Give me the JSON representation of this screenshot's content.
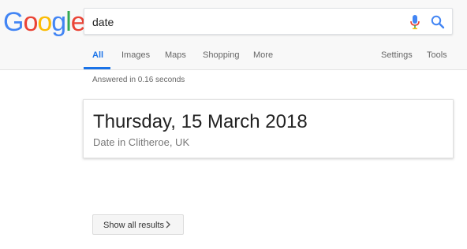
{
  "logo": {
    "letters": [
      "G",
      "o",
      "o",
      "g",
      "l",
      "e"
    ],
    "colors": [
      "#4285F4",
      "#EA4335",
      "#FBBC05",
      "#4285F4",
      "#34A853",
      "#EA4335"
    ]
  },
  "search": {
    "value": "date",
    "icons": {
      "mic": "mic-icon",
      "search": "search-icon"
    }
  },
  "tabs": {
    "items": [
      {
        "label": "All",
        "active": true
      },
      {
        "label": "Images"
      },
      {
        "label": "Maps"
      },
      {
        "label": "Shopping"
      },
      {
        "label": "More"
      }
    ],
    "right": [
      {
        "label": "Settings"
      },
      {
        "label": "Tools"
      }
    ]
  },
  "result_stats": "Answered in 0.16 seconds",
  "answer": {
    "date": "Thursday, 15 March 2018",
    "location": "Date in Clitheroe, UK"
  },
  "show_all": {
    "label": "Show all results",
    "icon": "chevron-right-icon"
  },
  "colors": {
    "accent": "#1a73e8",
    "header_bg": "#f8f8f8"
  }
}
